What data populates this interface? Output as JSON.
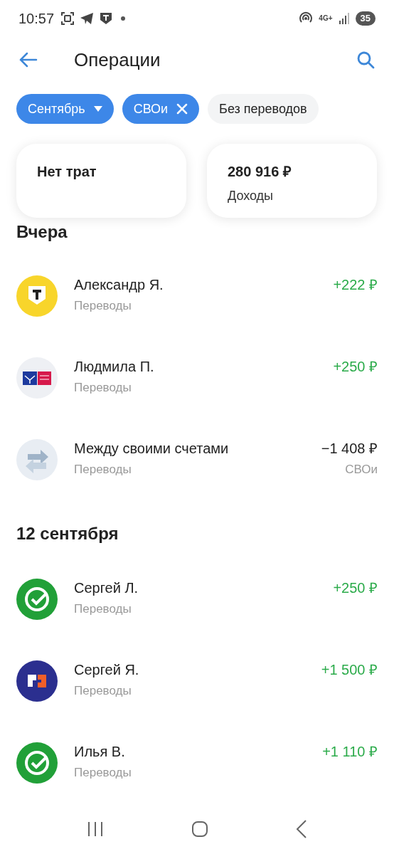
{
  "status_bar": {
    "time": "10:57",
    "network": "4G+",
    "battery": "35"
  },
  "header": {
    "title": "Операции"
  },
  "filters": [
    {
      "label": "Сентябрь",
      "selected": true,
      "kind": "dropdown"
    },
    {
      "label": "СВОи",
      "selected": true,
      "kind": "removable"
    },
    {
      "label": "Без переводов",
      "selected": false,
      "kind": "plain"
    }
  ],
  "summary": [
    {
      "value": "Нет трат"
    },
    {
      "value": "280 916 ₽",
      "caption": "Доходы"
    }
  ],
  "groups": [
    {
      "date": "Вчера",
      "operations": [
        {
          "kind": "tbank",
          "name": "Александр Я.",
          "category": "Переводы",
          "amount": "+222 ₽",
          "income": true
        },
        {
          "kind": "pochta",
          "name": "Людмила П.",
          "category": "Переводы",
          "amount": "+250 ₽",
          "income": true
        },
        {
          "kind": "transfer",
          "name": "Между своими счетами",
          "category": "Переводы",
          "amount": "−1 408 ₽",
          "income": false,
          "account": "СВОи"
        }
      ]
    },
    {
      "date": "12 сентября",
      "operations": [
        {
          "kind": "sber",
          "name": "Сергей Л.",
          "category": "Переводы",
          "amount": "+250 ₽",
          "income": true
        },
        {
          "kind": "domrf",
          "name": "Сергей Я.",
          "category": "Переводы",
          "amount": "+1 500 ₽",
          "income": true
        },
        {
          "kind": "sber",
          "name": "Илья В.",
          "category": "Переводы",
          "amount": "+1 110 ₽",
          "income": true
        }
      ]
    }
  ]
}
